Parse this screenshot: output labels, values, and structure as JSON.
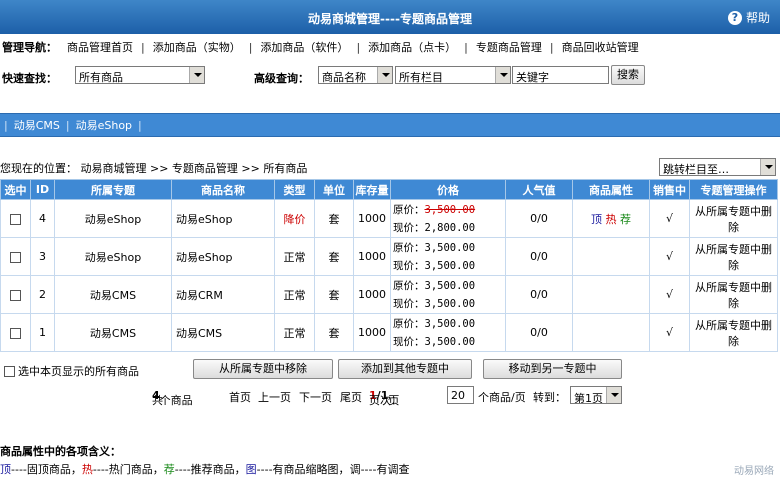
{
  "header": {
    "title": "动易商城管理----专题商品管理",
    "help_label": "帮助"
  },
  "nav": {
    "label": "管理导航：",
    "links": [
      "商品管理首页",
      "添加商品（实物）",
      "添加商品（软件）",
      "添加商品（点卡）",
      "专题商品管理",
      "商品回收站管理"
    ],
    "separator": "|"
  },
  "search": {
    "quick_label": "快速查找：",
    "quick_select": "所有商品",
    "advanced_label": "高级查询：",
    "field_select": "商品名称",
    "column_select": "所有栏目",
    "keyword_value": "关键字",
    "search_button": "搜索"
  },
  "tabs": [
    "动易CMS",
    "动易eShop"
  ],
  "location": {
    "text": "您现在的位置： 动易商城管理 >> 专题商品管理 >> 所有商品",
    "jump_select": "跳转栏目至…"
  },
  "table": {
    "headers": [
      "选中",
      "ID",
      "所属专题",
      "商品名称",
      "类型",
      "单位",
      "库存量",
      "价格",
      "人气值",
      "商品属性",
      "销售中",
      "专题管理操作"
    ],
    "rows": [
      {
        "id": "4",
        "topic": "动易eShop",
        "name": "动易eShop",
        "type": "降价",
        "unit": "套",
        "stock": "1000",
        "orig_label": "原价：",
        "orig": "3,500.00",
        "now_label": "现价：",
        "now": "2,800.00",
        "pop": "0/0",
        "attr_top": "顶",
        "attr_hot": "热",
        "attr_rec": "荐",
        "on_sale": "√",
        "action": "从所属专题中删除"
      },
      {
        "id": "3",
        "topic": "动易eShop",
        "name": "动易eShop",
        "type": "正常",
        "unit": "套",
        "stock": "1000",
        "orig_label": "原价：",
        "orig": "3,500.00",
        "now_label": "现价：",
        "now": "3,500.00",
        "pop": "0/0",
        "attr_top": "",
        "attr_hot": "",
        "attr_rec": "",
        "on_sale": "√",
        "action": "从所属专题中删除"
      },
      {
        "id": "2",
        "topic": "动易CMS",
        "name": "动易CRM",
        "type": "正常",
        "unit": "套",
        "stock": "1000",
        "orig_label": "原价：",
        "orig": "3,500.00",
        "now_label": "现价：",
        "now": "3,500.00",
        "pop": "0/0",
        "attr_top": "",
        "attr_hot": "",
        "attr_rec": "",
        "on_sale": "√",
        "action": "从所属专题中删除"
      },
      {
        "id": "1",
        "topic": "动易CMS",
        "name": "动易CMS",
        "type": "正常",
        "unit": "套",
        "stock": "1000",
        "orig_label": "原价：",
        "orig": "3,500.00",
        "now_label": "现价：",
        "now": "3,500.00",
        "pop": "0/0",
        "attr_top": "",
        "attr_hot": "",
        "attr_rec": "",
        "on_sale": "√",
        "action": "从所属专题中删除"
      }
    ]
  },
  "actions": {
    "select_all_label": "选中本页显示的所有商品",
    "remove_button": "从所属专题中移除",
    "add_button": "添加到其他专题中",
    "move_button": "移动到另一专题中"
  },
  "pager": {
    "total_prefix": "共",
    "total": "4",
    "total_suffix": "个商品",
    "first": "首页",
    "prev": "上一页",
    "next": "下一页",
    "last": "尾页",
    "page_label": "页次：",
    "page_current": "1",
    "page_sep": "/",
    "page_total": "1",
    "page_unit": "页",
    "per_page": "20",
    "per_page_suffix": "个商品/页",
    "goto_label": "转到：",
    "goto_select": "第1页"
  },
  "legend": {
    "title": "商品属性中的各项含义：",
    "top": "顶",
    "top_desc": "----固顶商品，",
    "hot": "热",
    "hot_desc": "----热门商品，",
    "rec": "荐",
    "rec_desc": "----推荐商品，",
    "pic": "图",
    "pic_desc": "----有商品缩略图，",
    "survey": "调",
    "survey_desc": "----有调查"
  },
  "watermark": "动易网络",
  "colors": {
    "header_blue": "#3f89d4",
    "title_dark_blue": "#1d5fa8",
    "price_red": "#cc0000"
  }
}
